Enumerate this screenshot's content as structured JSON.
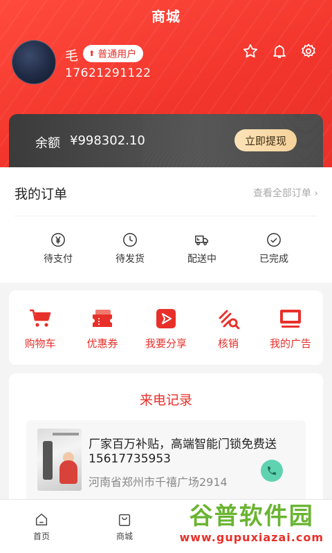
{
  "header": {
    "title": "商城",
    "username": "毛",
    "level_badge": "普通用户",
    "phone": "17621291122",
    "icons": [
      "star-icon",
      "bell-icon",
      "gear-icon"
    ]
  },
  "balance": {
    "label": "余额",
    "value": "¥998302.10",
    "withdraw_label": "立即提现"
  },
  "orders": {
    "title": "我的订单",
    "view_all": "查看全部订单 ›",
    "statuses": [
      {
        "label": "待支付",
        "icon": "yen-icon"
      },
      {
        "label": "待发货",
        "icon": "clock-icon"
      },
      {
        "label": "配送中",
        "icon": "truck-icon"
      },
      {
        "label": "已完成",
        "icon": "check-circle-icon"
      }
    ]
  },
  "tools": [
    {
      "label": "购物车",
      "icon": "cart-icon"
    },
    {
      "label": "优惠券",
      "icon": "coupon-icon"
    },
    {
      "label": "我要分享",
      "icon": "share-icon"
    },
    {
      "label": "核销",
      "icon": "verify-icon"
    },
    {
      "label": "我的广告",
      "icon": "ad-monitor-icon"
    }
  ],
  "calls": {
    "title": "来电记录",
    "items": [
      {
        "headline": "厂家百万补贴，高端智能门锁免费送",
        "phone": "15617735953",
        "address": "河南省郑州市千禧广场2914"
      }
    ]
  },
  "tabbar": [
    {
      "label": "首页",
      "icon": "home-icon"
    },
    {
      "label": "商城",
      "icon": "shopping-bag-icon"
    }
  ],
  "watermark": {
    "text": "谷普软件园",
    "url": "www.gupuxiazai.com"
  },
  "colors": {
    "accent": "#e8302a",
    "withdraw_button": "#f6d29a",
    "call_button": "#5fd3b0",
    "watermark_green": "#69b431"
  }
}
